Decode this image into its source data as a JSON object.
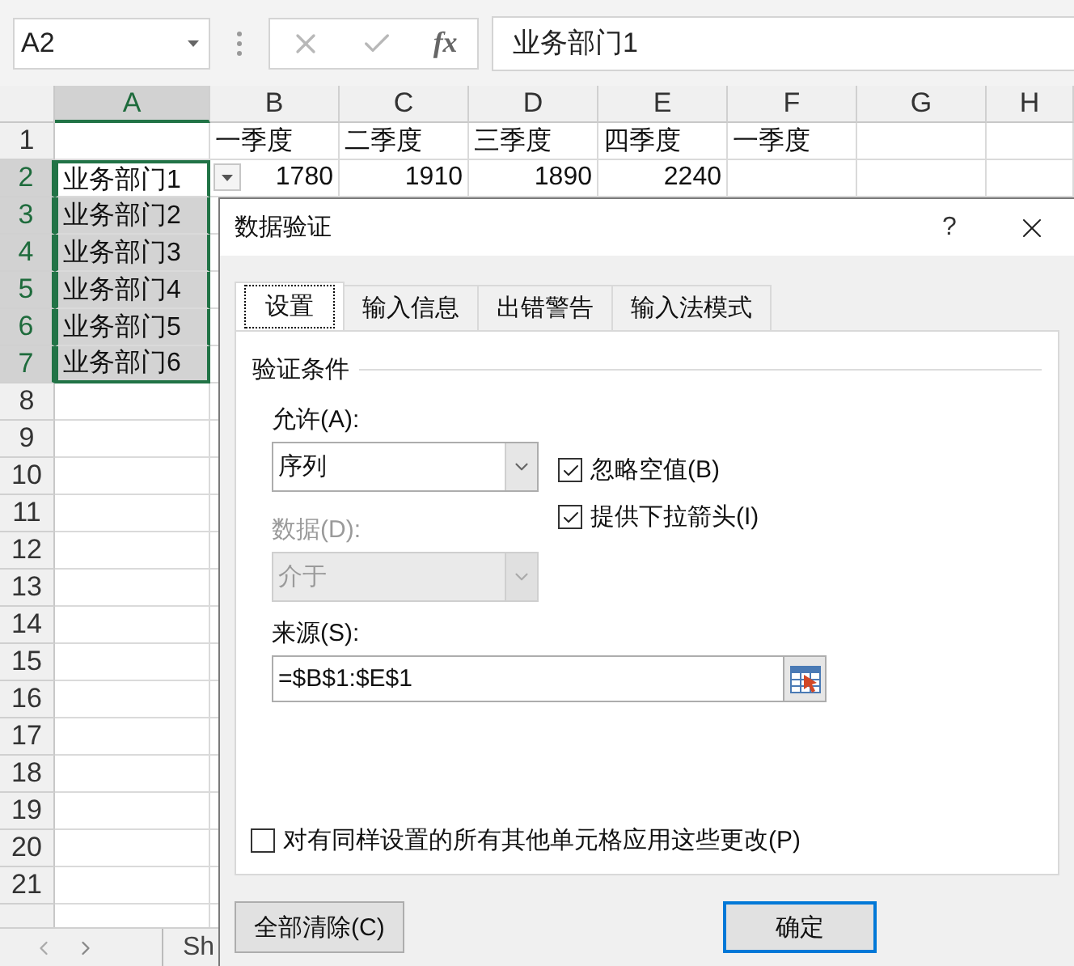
{
  "name_box": {
    "value": "A2"
  },
  "formula_bar": {
    "function_label": "fx",
    "value": "业务部门1"
  },
  "columns": [
    {
      "label": "A",
      "selected": true
    },
    {
      "label": "B",
      "selected": false
    },
    {
      "label": "C",
      "selected": false
    },
    {
      "label": "D",
      "selected": false
    },
    {
      "label": "E",
      "selected": false
    },
    {
      "label": "F",
      "selected": false
    },
    {
      "label": "G",
      "selected": false
    },
    {
      "label": "H",
      "selected": false
    }
  ],
  "rows": [
    {
      "number": "1",
      "selected": false,
      "cells": [
        null,
        {
          "text": "一季度",
          "kind": "text"
        },
        {
          "text": "二季度",
          "kind": "text"
        },
        {
          "text": "三季度",
          "kind": "text"
        },
        {
          "text": "四季度",
          "kind": "text"
        },
        {
          "text": "一季度",
          "kind": "text"
        }
      ]
    },
    {
      "number": "2",
      "selected": true,
      "dropdown": true,
      "cells": [
        {
          "text": "业务部门1",
          "kind": "text",
          "selected": false
        },
        {
          "text": "1780",
          "kind": "number"
        },
        {
          "text": "1910",
          "kind": "number"
        },
        {
          "text": "1890",
          "kind": "number"
        },
        {
          "text": "2240",
          "kind": "number"
        }
      ]
    },
    {
      "number": "3",
      "selected": true,
      "cells": [
        {
          "text": "业务部门2",
          "kind": "text",
          "selected": true
        }
      ]
    },
    {
      "number": "4",
      "selected": true,
      "cells": [
        {
          "text": "业务部门3",
          "kind": "text",
          "selected": true
        }
      ]
    },
    {
      "number": "5",
      "selected": true,
      "cells": [
        {
          "text": "业务部门4",
          "kind": "text",
          "selected": true
        }
      ]
    },
    {
      "number": "6",
      "selected": true,
      "cells": [
        {
          "text": "业务部门5",
          "kind": "text",
          "selected": true
        }
      ]
    },
    {
      "number": "7",
      "selected": true,
      "cells": [
        {
          "text": "业务部门6",
          "kind": "text",
          "selected": true
        }
      ]
    },
    {
      "number": "8",
      "selected": false,
      "cells": []
    },
    {
      "number": "9",
      "selected": false,
      "cells": []
    },
    {
      "number": "10",
      "selected": false,
      "cells": []
    },
    {
      "number": "11",
      "selected": false,
      "cells": []
    },
    {
      "number": "12",
      "selected": false,
      "cells": []
    },
    {
      "number": "13",
      "selected": false,
      "cells": []
    },
    {
      "number": "14",
      "selected": false,
      "cells": []
    },
    {
      "number": "15",
      "selected": false,
      "cells": []
    },
    {
      "number": "16",
      "selected": false,
      "cells": []
    },
    {
      "number": "17",
      "selected": false,
      "cells": []
    },
    {
      "number": "18",
      "selected": false,
      "cells": []
    },
    {
      "number": "19",
      "selected": false,
      "cells": []
    },
    {
      "number": "20",
      "selected": false,
      "cells": []
    },
    {
      "number": "21",
      "selected": false,
      "cells": []
    },
    {
      "selected": false,
      "cells": []
    }
  ],
  "sheet_tabs": [
    {
      "label": "Sh"
    }
  ],
  "dialog": {
    "title": "数据验证",
    "help": "?",
    "tabs": [
      {
        "label": "设置",
        "selected": true
      },
      {
        "label": "输入信息",
        "selected": false
      },
      {
        "label": "出错警告",
        "selected": false
      },
      {
        "label": "输入法模式",
        "selected": false
      }
    ],
    "group_title": "验证条件",
    "allow": {
      "label": "允许(A):",
      "value": "序列",
      "disabled": false
    },
    "data": {
      "label": "数据(D):",
      "value": "介于",
      "disabled": true
    },
    "checkboxes": [
      {
        "label": "忽略空值(B)",
        "checked": true
      },
      {
        "label": "提供下拉箭头(I)",
        "checked": true
      }
    ],
    "source": {
      "label": "来源(S):",
      "value": "=$B$1:$E$1"
    },
    "apply_all": {
      "label": "对有同样设置的所有其他单元格应用这些更改(P)",
      "checked": false
    },
    "buttons": [
      {
        "label": "全部清除(C)",
        "default": false
      },
      {
        "label": "确定",
        "default": true
      }
    ]
  }
}
